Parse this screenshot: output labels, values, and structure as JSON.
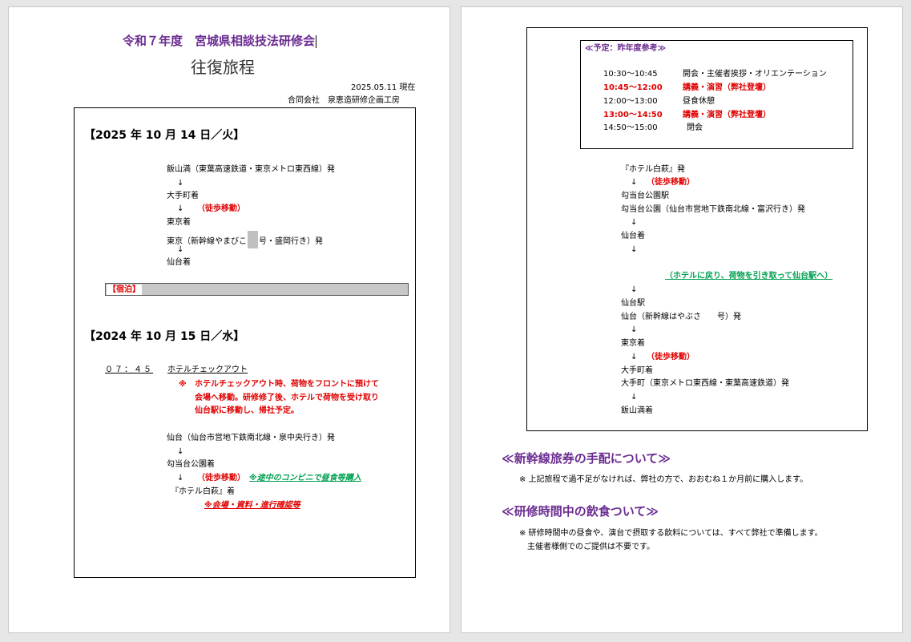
{
  "page1": {
    "title": "令和７年度　宮城県相談技法研修会",
    "subtitle": "往復旅程",
    "date_line": "2025.05.11 現在",
    "company": "合同会社　泉恵造研修企画工房",
    "day1": {
      "header": "【2025 年 10 月 14 日／火】",
      "lines": {
        "l1": "飯山満（東葉高速鉄道・東京メトロ東西線）発",
        "a1": "↓",
        "l2": "大手町着",
        "a2": "↓",
        "walk": "（徒歩移動）",
        "l3": "東京着",
        "l4a": "東京（新幹線やまびこ",
        "l4b": "号・盛岡行き）発",
        "a3": "↓",
        "l5": "仙台着"
      },
      "stay_label": "【宿泊】"
    },
    "day2": {
      "header": "【2024 年 10 月 15 日／水】",
      "time": "０７：４５",
      "checkout": "ホテルチェックアウト",
      "note_mark": "※",
      "note1": "ホテルチェックアウト時、荷物をフロントに預けて",
      "note2": "会場へ移動。研修修了後、ホテルで荷物を受け取り",
      "note3": "仙台駅に移動し、帰社予定。",
      "l1": "仙台（仙台市営地下鉄南北線・泉中央行き）発",
      "a1": "↓",
      "l2": "勾当台公園着",
      "a2": "↓",
      "walk": "（徒歩移動）",
      "conv": "※途中のコンビニで昼食等購入",
      "l3": "『ホテル白萩』着",
      "confirm": "※会場・資料・進行確認等"
    }
  },
  "page2": {
    "schedule": {
      "title": "≪予定：昨年度参考≫",
      "rows": [
        {
          "time": "10:30～10:45",
          "text": "開会・主催者挨拶・オリエンテーション",
          "highlight": false
        },
        {
          "time": "10:45～12:00",
          "text": "講義・演習（弊社登壇）",
          "highlight": true
        },
        {
          "time": "12:00～13:00",
          "text": "昼食休憩",
          "highlight": false
        },
        {
          "time": "13:00～14:50",
          "text": "講義・演習（弊社登壇）",
          "highlight": true
        },
        {
          "time": "14:50～15:00",
          "text": "閉会",
          "highlight": false
        }
      ]
    },
    "ret": {
      "l1": "『ホテル白萩』発",
      "a1": "↓",
      "walk1": "（徒歩移動）",
      "l2": "勾当台公園駅",
      "l3": "勾当台公園（仙台市営地下鉄南北線・富沢行き）発",
      "a2": "↓",
      "l4": "仙台着",
      "a3": "↓",
      "green_note": "（ホテルに戻り、荷物を引き取って仙台駅へ）",
      "a4": "↓",
      "l5": "仙台駅",
      "l6": "仙台（新幹線はやぶさ　　号）発",
      "a5": "↓",
      "l7": "東京着",
      "a6": "↓",
      "walk2": "（徒歩移動）",
      "l8": "大手町着",
      "l9": "大手町（東京メトロ東西線・東葉高速鉄道）発",
      "a7": "↓",
      "l10": "飯山満着"
    },
    "sec1": {
      "heading": "≪新幹線旅券の手配について≫",
      "body": "※ 上記旅程で過不足がなければ、弊社の方で、おおむね１か月前に購入します。"
    },
    "sec2": {
      "heading": "≪研修時間中の飲食ついて≫",
      "body1": "※ 研修時間中の昼食や、演台で摂取する飲料については、すべて弊社で準備します。",
      "body2": "主催者様側でのご提供は不要です。"
    }
  }
}
